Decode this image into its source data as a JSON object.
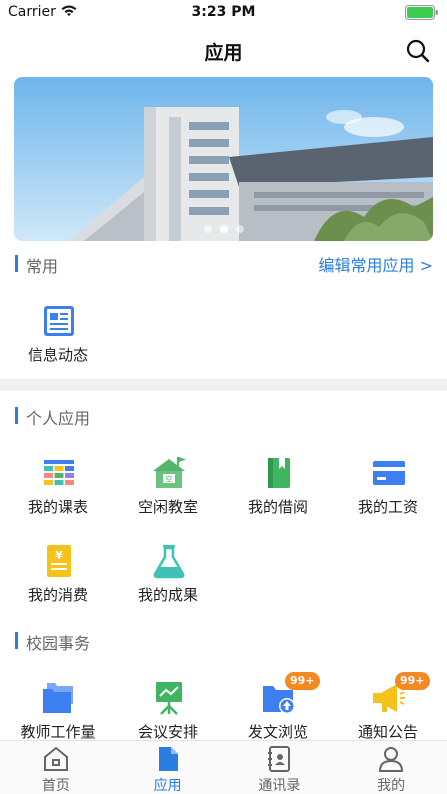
{
  "status_bar": {
    "carrier": "Carrier",
    "time": "3:23 PM"
  },
  "nav": {
    "title": "应用"
  },
  "banner": {
    "slide_count": 3,
    "active_slide": 2
  },
  "common": {
    "section_title": "常用",
    "edit_label": "编辑常用应用 >",
    "items": [
      {
        "label": "信息动态",
        "icon": "news-icon"
      }
    ]
  },
  "personal": {
    "section_title": "个人应用",
    "items": [
      {
        "label": "我的课表",
        "icon": "schedule-grid-icon"
      },
      {
        "label": "空闲教室",
        "icon": "classroom-icon"
      },
      {
        "label": "我的借阅",
        "icon": "book-icon"
      },
      {
        "label": "我的工资",
        "icon": "wallet-card-icon"
      },
      {
        "label": "我的消费",
        "icon": "receipt-icon"
      },
      {
        "label": "我的成果",
        "icon": "flask-icon"
      }
    ]
  },
  "campus": {
    "section_title": "校园事务",
    "items": [
      {
        "label": "教师工作量",
        "icon": "folders-icon"
      },
      {
        "label": "会议安排",
        "icon": "presentation-board-icon"
      },
      {
        "label": "发文浏览",
        "icon": "folder-upload-icon",
        "badge": "99+"
      },
      {
        "label": "通知公告",
        "icon": "megaphone-icon",
        "badge": "99+"
      }
    ]
  },
  "tabs": [
    {
      "label": "首页",
      "icon": "home-icon",
      "active": false
    },
    {
      "label": "应用",
      "icon": "document-icon",
      "active": true
    },
    {
      "label": "通讯录",
      "icon": "contacts-book-icon",
      "active": false
    },
    {
      "label": "我的",
      "icon": "person-icon",
      "active": false
    }
  ],
  "colors": {
    "accent": "#2a7de1",
    "badge": "#f28a23",
    "icon_blue": "#3d7ef0",
    "icon_green": "#52b56a",
    "icon_yellow": "#f5c21b",
    "icon_teal": "#3fc2b5"
  }
}
